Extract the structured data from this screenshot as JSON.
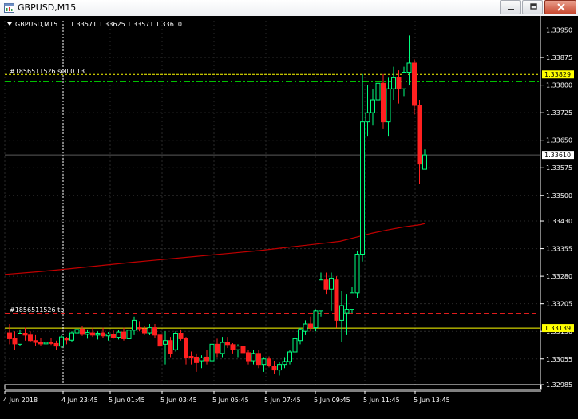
{
  "window": {
    "title": "GBPUSD,M15",
    "buttons": [
      "minimize",
      "restore",
      "close"
    ]
  },
  "chart_header": {
    "symbol": "GBPUSD,M15",
    "ohlc": "1.33571 1.33625 1.33571 1.33610"
  },
  "order_labels": {
    "sell": "#1856511526 sell 0.13",
    "tp": "#1856511526 tp"
  },
  "price_axis": {
    "ticks": [
      "1.33950",
      "1.33875",
      "1.33800",
      "1.33725",
      "1.33650",
      "1.33575",
      "1.33500",
      "1.33430",
      "1.33355",
      "1.33280",
      "1.33205",
      "1.33130",
      "1.33055",
      "1.32985"
    ],
    "sell_tag": "1.33829",
    "current_tag": "1.33610",
    "tp_tag": "1.33139"
  },
  "time_axis": {
    "ticks": [
      "4 Jun 2018",
      "4 Jun 23:45",
      "5 Jun 01:45",
      "5 Jun 03:45",
      "5 Jun 05:45",
      "5 Jun 07:45",
      "5 Jun 09:45",
      "5 Jun 11:45",
      "5 Jun 13:45"
    ]
  },
  "colors": {
    "background": "#000000",
    "grid": "#2a2a2a",
    "bull": "#00ff7f",
    "bear": "#ff2020",
    "moving_average": "#c00000",
    "sell_line": "#ffff00",
    "tp_line": "#ff2020",
    "stop_line": "#00c000",
    "axis_text": "#ffffff",
    "tag_bg": "#ffff00"
  },
  "chart_data": {
    "type": "candlestick",
    "title": "GBPUSD,M15",
    "ylim": [
      1.32985,
      1.33975
    ],
    "moving_average": [
      [
        0,
        1.33285
      ],
      [
        40,
        1.33292
      ],
      [
        80,
        1.333
      ],
      [
        120,
        1.33309
      ],
      [
        160,
        1.33318
      ],
      [
        200,
        1.33326
      ],
      [
        240,
        1.33334
      ],
      [
        280,
        1.33342
      ],
      [
        320,
        1.3335
      ],
      [
        360,
        1.3336
      ],
      [
        400,
        1.3337
      ],
      [
        420,
        1.33375
      ],
      [
        440,
        1.33386
      ],
      [
        460,
        1.33397
      ],
      [
        480,
        1.33406
      ],
      [
        500,
        1.33414
      ],
      [
        520,
        1.3342
      ],
      [
        526,
        1.33423
      ]
    ],
    "candles": [
      {
        "o": 1.33126,
        "h": 1.3315,
        "l": 1.33095,
        "c": 1.3311
      },
      {
        "o": 1.3311,
        "h": 1.3313,
        "l": 1.3308,
        "c": 1.33096
      },
      {
        "o": 1.33095,
        "h": 1.33135,
        "l": 1.3309,
        "c": 1.33125
      },
      {
        "o": 1.33125,
        "h": 1.3314,
        "l": 1.33105,
        "c": 1.3312
      },
      {
        "o": 1.3312,
        "h": 1.3313,
        "l": 1.331,
        "c": 1.33105
      },
      {
        "o": 1.33105,
        "h": 1.3312,
        "l": 1.3309,
        "c": 1.331
      },
      {
        "o": 1.331,
        "h": 1.33112,
        "l": 1.3309,
        "c": 1.33096
      },
      {
        "o": 1.33096,
        "h": 1.33106,
        "l": 1.3309,
        "c": 1.331
      },
      {
        "o": 1.331,
        "h": 1.33112,
        "l": 1.33093,
        "c": 1.33097
      },
      {
        "o": 1.33097,
        "h": 1.33105,
        "l": 1.3308,
        "c": 1.3309
      },
      {
        "o": 1.3309,
        "h": 1.3312,
        "l": 1.33085,
        "c": 1.33115
      },
      {
        "o": 1.3311,
        "h": 1.33115,
        "l": 1.33095,
        "c": 1.33107
      },
      {
        "o": 1.33106,
        "h": 1.3313,
        "l": 1.331,
        "c": 1.33126
      },
      {
        "o": 1.33126,
        "h": 1.33145,
        "l": 1.33115,
        "c": 1.33135
      },
      {
        "o": 1.33136,
        "h": 1.33145,
        "l": 1.33118,
        "c": 1.33122
      },
      {
        "o": 1.33122,
        "h": 1.33135,
        "l": 1.3311,
        "c": 1.33127
      },
      {
        "o": 1.33126,
        "h": 1.3314,
        "l": 1.33115,
        "c": 1.3312
      },
      {
        "o": 1.3312,
        "h": 1.3313,
        "l": 1.33108,
        "c": 1.33125
      },
      {
        "o": 1.33126,
        "h": 1.3314,
        "l": 1.33112,
        "c": 1.33118
      },
      {
        "o": 1.33118,
        "h": 1.33128,
        "l": 1.33105,
        "c": 1.33123
      },
      {
        "o": 1.33122,
        "h": 1.33132,
        "l": 1.3311,
        "c": 1.33114
      },
      {
        "o": 1.33114,
        "h": 1.33133,
        "l": 1.33108,
        "c": 1.33128
      },
      {
        "o": 1.33128,
        "h": 1.3314,
        "l": 1.33105,
        "c": 1.3311
      },
      {
        "o": 1.3311,
        "h": 1.3314,
        "l": 1.331,
        "c": 1.33133
      },
      {
        "o": 1.33133,
        "h": 1.3317,
        "l": 1.3312,
        "c": 1.3316
      },
      {
        "o": 1.3314,
        "h": 1.33158,
        "l": 1.3313,
        "c": 1.33137
      },
      {
        "o": 1.33137,
        "h": 1.33145,
        "l": 1.3312,
        "c": 1.33126
      },
      {
        "o": 1.33126,
        "h": 1.3315,
        "l": 1.3312,
        "c": 1.3314
      },
      {
        "o": 1.3314,
        "h": 1.3315,
        "l": 1.33112,
        "c": 1.3312
      },
      {
        "o": 1.3312,
        "h": 1.3313,
        "l": 1.33085,
        "c": 1.3309
      },
      {
        "o": 1.33095,
        "h": 1.3313,
        "l": 1.3304,
        "c": 1.33105
      },
      {
        "o": 1.33105,
        "h": 1.33115,
        "l": 1.3306,
        "c": 1.3307
      },
      {
        "o": 1.3308,
        "h": 1.3313,
        "l": 1.33075,
        "c": 1.33125
      },
      {
        "o": 1.33125,
        "h": 1.33135,
        "l": 1.33105,
        "c": 1.3311
      },
      {
        "o": 1.3311,
        "h": 1.33115,
        "l": 1.3304,
        "c": 1.33058
      },
      {
        "o": 1.33062,
        "h": 1.33075,
        "l": 1.3304,
        "c": 1.3306
      },
      {
        "o": 1.3306,
        "h": 1.3307,
        "l": 1.3302,
        "c": 1.33045
      },
      {
        "o": 1.3305,
        "h": 1.33065,
        "l": 1.3303,
        "c": 1.33058
      },
      {
        "o": 1.3306,
        "h": 1.3308,
        "l": 1.3304,
        "c": 1.3305
      },
      {
        "o": 1.3305,
        "h": 1.331,
        "l": 1.3304,
        "c": 1.33095
      },
      {
        "o": 1.33095,
        "h": 1.3311,
        "l": 1.3306,
        "c": 1.33072
      },
      {
        "o": 1.3307,
        "h": 1.33115,
        "l": 1.3306,
        "c": 1.331
      },
      {
        "o": 1.331,
        "h": 1.33115,
        "l": 1.33085,
        "c": 1.33094
      },
      {
        "o": 1.33094,
        "h": 1.33098,
        "l": 1.3307,
        "c": 1.3308
      },
      {
        "o": 1.3308,
        "h": 1.33095,
        "l": 1.3306,
        "c": 1.3309
      },
      {
        "o": 1.3309,
        "h": 1.33098,
        "l": 1.33064,
        "c": 1.33072
      },
      {
        "o": 1.33072,
        "h": 1.3308,
        "l": 1.3304,
        "c": 1.3305
      },
      {
        "o": 1.3305,
        "h": 1.3308,
        "l": 1.3304,
        "c": 1.3307
      },
      {
        "o": 1.3307,
        "h": 1.3308,
        "l": 1.3303,
        "c": 1.3304
      },
      {
        "o": 1.3304,
        "h": 1.3306,
        "l": 1.3302,
        "c": 1.33055
      },
      {
        "o": 1.33055,
        "h": 1.33062,
        "l": 1.33032,
        "c": 1.33036
      },
      {
        "o": 1.33036,
        "h": 1.3305,
        "l": 1.33015,
        "c": 1.33025
      },
      {
        "o": 1.33025,
        "h": 1.33048,
        "l": 1.3301,
        "c": 1.3304
      },
      {
        "o": 1.3304,
        "h": 1.3306,
        "l": 1.3303,
        "c": 1.33048
      },
      {
        "o": 1.33048,
        "h": 1.3308,
        "l": 1.3304,
        "c": 1.33074
      },
      {
        "o": 1.33074,
        "h": 1.33125,
        "l": 1.3307,
        "c": 1.3311
      },
      {
        "o": 1.33105,
        "h": 1.3314,
        "l": 1.33095,
        "c": 1.33135
      },
      {
        "o": 1.3313,
        "h": 1.3316,
        "l": 1.3312,
        "c": 1.3315
      },
      {
        "o": 1.3315,
        "h": 1.3317,
        "l": 1.3313,
        "c": 1.3314
      },
      {
        "o": 1.3314,
        "h": 1.3319,
        "l": 1.3313,
        "c": 1.33185
      },
      {
        "o": 1.33185,
        "h": 1.3329,
        "l": 1.3317,
        "c": 1.3327
      },
      {
        "o": 1.3327,
        "h": 1.3329,
        "l": 1.3323,
        "c": 1.33245
      },
      {
        "o": 1.33245,
        "h": 1.3329,
        "l": 1.33185,
        "c": 1.33275
      },
      {
        "o": 1.3327,
        "h": 1.3328,
        "l": 1.3314,
        "c": 1.3316
      },
      {
        "o": 1.3316,
        "h": 1.3324,
        "l": 1.331,
        "c": 1.332
      },
      {
        "o": 1.3318,
        "h": 1.3323,
        "l": 1.3312,
        "c": 1.3319
      },
      {
        "o": 1.3319,
        "h": 1.3325,
        "l": 1.3318,
        "c": 1.33235
      },
      {
        "o": 1.33235,
        "h": 1.3335,
        "l": 1.3322,
        "c": 1.3334
      },
      {
        "o": 1.3334,
        "h": 1.3383,
        "l": 1.3332,
        "c": 1.337
      },
      {
        "o": 1.337,
        "h": 1.338,
        "l": 1.3366,
        "c": 1.33725
      },
      {
        "o": 1.33725,
        "h": 1.3379,
        "l": 1.3369,
        "c": 1.3376
      },
      {
        "o": 1.3376,
        "h": 1.3384,
        "l": 1.3374,
        "c": 1.33805
      },
      {
        "o": 1.33805,
        "h": 1.3383,
        "l": 1.3368,
        "c": 1.337
      },
      {
        "o": 1.337,
        "h": 1.3382,
        "l": 1.3366,
        "c": 1.3379
      },
      {
        "o": 1.3379,
        "h": 1.3385,
        "l": 1.3376,
        "c": 1.3382
      },
      {
        "o": 1.3382,
        "h": 1.3384,
        "l": 1.3375,
        "c": 1.3379
      },
      {
        "o": 1.3379,
        "h": 1.3385,
        "l": 1.3377,
        "c": 1.33835
      },
      {
        "o": 1.33835,
        "h": 1.33935,
        "l": 1.338,
        "c": 1.3386
      },
      {
        "o": 1.3386,
        "h": 1.3387,
        "l": 1.3372,
        "c": 1.33745
      },
      {
        "o": 1.33745,
        "h": 1.3376,
        "l": 1.3353,
        "c": 1.33585
      },
      {
        "o": 1.33571,
        "h": 1.33625,
        "l": 1.33571,
        "c": 1.3361
      }
    ]
  }
}
